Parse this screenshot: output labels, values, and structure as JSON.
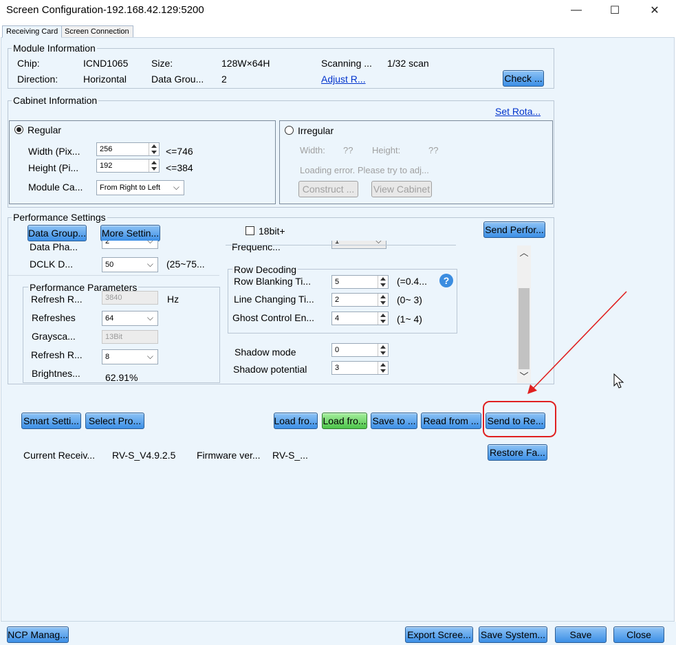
{
  "window": {
    "title": "Screen Configuration-192.168.42.129:5200",
    "minimize_glyph": "—",
    "maximize_glyph": "☐",
    "close_glyph": "✕"
  },
  "tabs": [
    {
      "label": "Receiving Card",
      "active": true
    },
    {
      "label": "Screen Connection",
      "active": false
    }
  ],
  "module_info": {
    "title": "Module Information",
    "chip_label": "Chip:",
    "chip_value": "ICND1065",
    "size_label": "Size:",
    "size_value": "128W×64H",
    "scanning_label": "Scanning ...",
    "scanning_value": "1/32 scan",
    "direction_label": "Direction:",
    "direction_value": "Horizontal",
    "data_group_label": "Data Grou...",
    "data_group_value": "2",
    "adjust_link": "Adjust R...",
    "check_button": "Check ..."
  },
  "cabinet_info": {
    "title": "Cabinet Information",
    "set_rotation_link": "Set Rota...",
    "regular": {
      "label": "Regular",
      "selected": true,
      "width_label": "Width (Pix...",
      "width_value": "256",
      "width_limit": "<=746",
      "height_label": "Height (Pi...",
      "height_value": "192",
      "height_limit": "<=384",
      "module_cascade_label": "Module Ca...",
      "module_cascade_value": "From Right to Left"
    },
    "irregular": {
      "label": "Irregular",
      "selected": false,
      "width_label": "Width:",
      "width_value": "??",
      "height_label": "Height:",
      "height_value": "??",
      "error_text": "Loading error. Please try to adj...",
      "construct_button": "Construct ...",
      "view_cabinet_button": "View Cabinet"
    }
  },
  "performance": {
    "title": "Performance Settings",
    "data_group_button": "Data Group...",
    "more_settings_button": "More Settin...",
    "bit18_label": "18bit+",
    "bit18_checked": false,
    "send_button": "Send Perfor...",
    "cut_data_phase_label": "Data Pha...",
    "cut_data_phase_value": "2",
    "cut_frequency_label": "Frequenc...",
    "cut_frequency_value": "1",
    "dclk_label": "DCLK D...",
    "dclk_value": "50",
    "dclk_range": "(25~75...",
    "params": {
      "title": "Performance Parameters",
      "refresh_rate_label": "Refresh R...",
      "refresh_rate_value": "3840",
      "refresh_rate_unit": "Hz",
      "refreshes_label": "Refreshes",
      "refreshes_value": "64",
      "grayscale_label": "Graysca...",
      "grayscale_value": "13Bit",
      "refresh_r2_label": "Refresh R...",
      "refresh_r2_value": "8",
      "brightness_label": "Brightnes...",
      "brightness_value": "62.91%"
    },
    "row_decoding": {
      "title": "Row Decoding",
      "help_glyph": "?",
      "row_blanking_label": "Row Blanking Ti...",
      "row_blanking_value": "5",
      "row_blanking_range": "(=0.4...",
      "line_changing_label": "Line Changing Ti...",
      "line_changing_value": "2",
      "line_changing_range": "(0~ 3)",
      "ghost_label": "Ghost Control En...",
      "ghost_value": "4",
      "ghost_range": "(1~ 4)"
    },
    "shadow_mode_label": "Shadow mode",
    "shadow_mode_value": "0",
    "shadow_potential_label": "Shadow potential",
    "shadow_potential_value": "3",
    "scroll_up_glyph": "︿",
    "scroll_down_glyph": "﹀"
  },
  "actions": {
    "smart_settings": "Smart Setti...",
    "select_profile": "Select Pro...",
    "load_from_1": "Load fro...",
    "load_from_2": "Load fro...",
    "save_to": "Save to ...",
    "read_from": "Read from ...",
    "send_to_receiving": "Send to Re...",
    "restore_factory": "Restore Fa..."
  },
  "status": {
    "current_receiving_label": "Current Receiv...",
    "current_receiving_value": "RV-S_V4.9.2.5",
    "firmware_label": "Firmware ver...",
    "firmware_value": "RV-S_..."
  },
  "footer": {
    "ncp_manager": "NCP Manag...",
    "export_screen": "Export Scree...",
    "save_system": "Save System...",
    "save": "Save",
    "close": "Close"
  },
  "annotation": {
    "color": "#e02020"
  },
  "colors": {
    "button_blue": "#3c8fe6",
    "button_green": "#4dc44a",
    "panel_bg": "#ecf5fc",
    "link": "#0033cc"
  }
}
